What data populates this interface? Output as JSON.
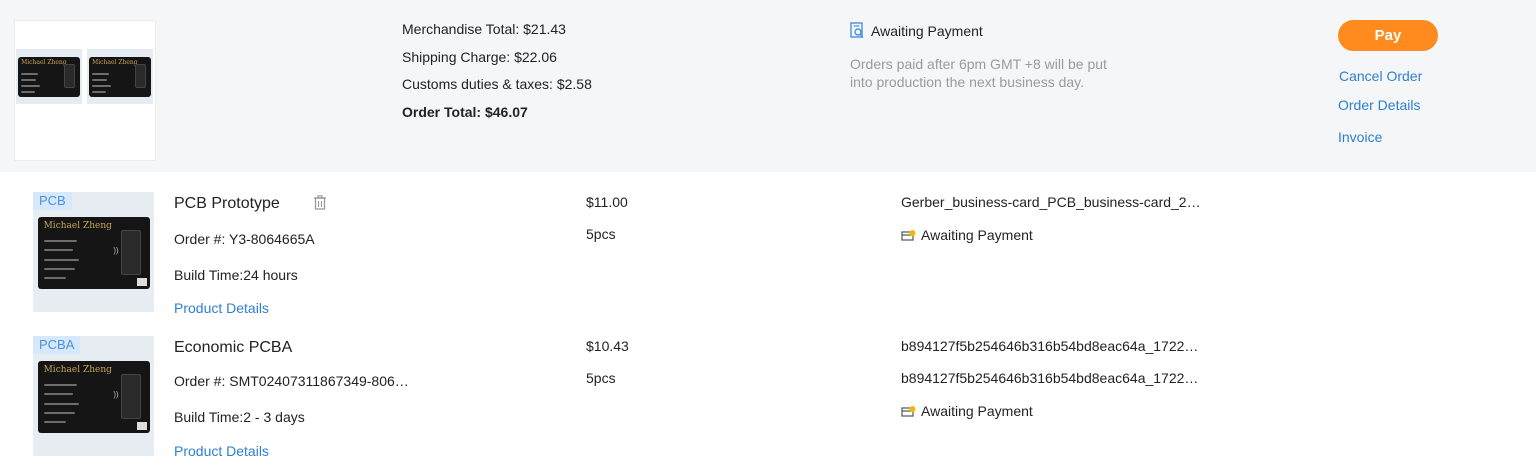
{
  "summary": {
    "merchandise_total": "Merchandise Total: $21.43",
    "shipping_charge": "Shipping Charge: $22.06",
    "customs": "Customs duties & taxes: $2.58",
    "order_total": "Order Total: $46.07",
    "status": "Awaiting Payment",
    "note": "Orders paid after 6pm GMT +8 will be put into production the next business day.",
    "pay_label": "Pay",
    "cancel_label": "Cancel Order",
    "details_label": "Order Details",
    "invoice_label": "Invoice",
    "thumb_card_name": "Michael Zheng"
  },
  "items": [
    {
      "tag": "PCB",
      "card_name": "Michael Zheng",
      "title": "PCB Prototype",
      "order_no": "Order #: Y3-8064665A",
      "build_time": "Build Time:24 hours",
      "details_link": "Product Details",
      "price": "$11.00",
      "qty": "5pcs",
      "file1": "Gerber_business-card_PCB_business-card_2…",
      "status": "Awaiting Payment"
    },
    {
      "tag": "PCBA",
      "card_name": "Michael Zheng",
      "title": "Economic PCBA",
      "order_no": "Order #: SMT02407311867349-806…",
      "build_time": "Build Time:2 - 3 days",
      "details_link": "Product Details",
      "price": "$10.43",
      "qty": "5pcs",
      "file1": "b894127f5b254646b316b54bd8eac64a_1722…",
      "file2": "b894127f5b254646b316b54bd8eac64a_1722…",
      "status": "Awaiting Payment"
    }
  ],
  "colors": {
    "accent_orange": "#ff8a1d",
    "link_blue": "#2f80d1",
    "summary_bg": "#f5f6f8"
  }
}
